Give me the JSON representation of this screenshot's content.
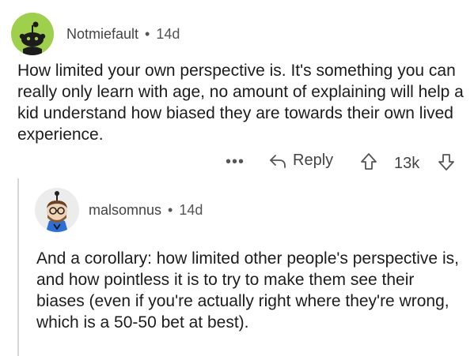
{
  "comment1": {
    "username": "Notmiefault",
    "separator": "•",
    "age": "14d",
    "avatar_icon": "snoo-avatar-icon",
    "avatar_color": "#9ed04c",
    "text": "How limited your own perspective is. It's something you can really only learn with age, no amount of explaining will help a kid understand how biased they are towards their own lived experience.",
    "actions": {
      "more_label": "•••",
      "reply_label": "Reply",
      "score": "13k"
    }
  },
  "comment2": {
    "username": "malsomnus",
    "separator": "•",
    "age": "14d",
    "avatar_icon": "custom-snoo-avatar-icon",
    "text": "And a corollary: how limited other people's perspective is, and how pointless it is to try to make them see their biases (even if you're actually right where they're wrong, which is a 50-50 bet at best)."
  }
}
